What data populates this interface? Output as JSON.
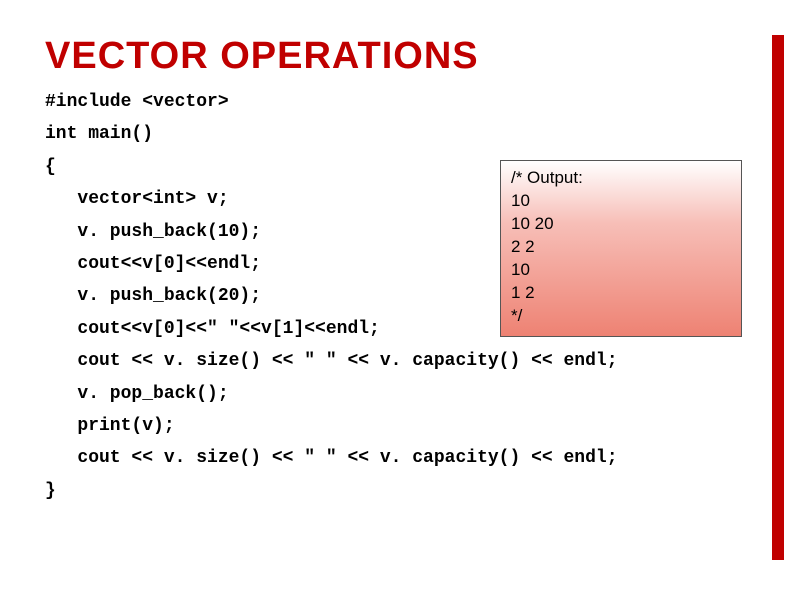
{
  "title": "VECTOR OPERATIONS",
  "code": {
    "l0": "#include <vector>",
    "l1": "int main()",
    "l2": "{",
    "l3": "   vector<int> v;",
    "l4": "   v. push_back(10);",
    "l5": "   cout<<v[0]<<endl;",
    "l6": "   v. push_back(20);",
    "l7": "   cout<<v[0]<<\" \"<<v[1]<<endl;",
    "l8": "   cout << v. size() << \" \" << v. capacity() << endl;",
    "l9": "   v. pop_back();",
    "l10": "   print(v);",
    "l11": "   cout << v. size() << \" \" << v. capacity() << endl;",
    "l12": "}"
  },
  "output": {
    "o0": "/* Output:",
    "o1": "10",
    "o2": "10 20",
    "o3": "2 2",
    "o4": "10",
    "o5": "1 2",
    "o6": "*/"
  }
}
